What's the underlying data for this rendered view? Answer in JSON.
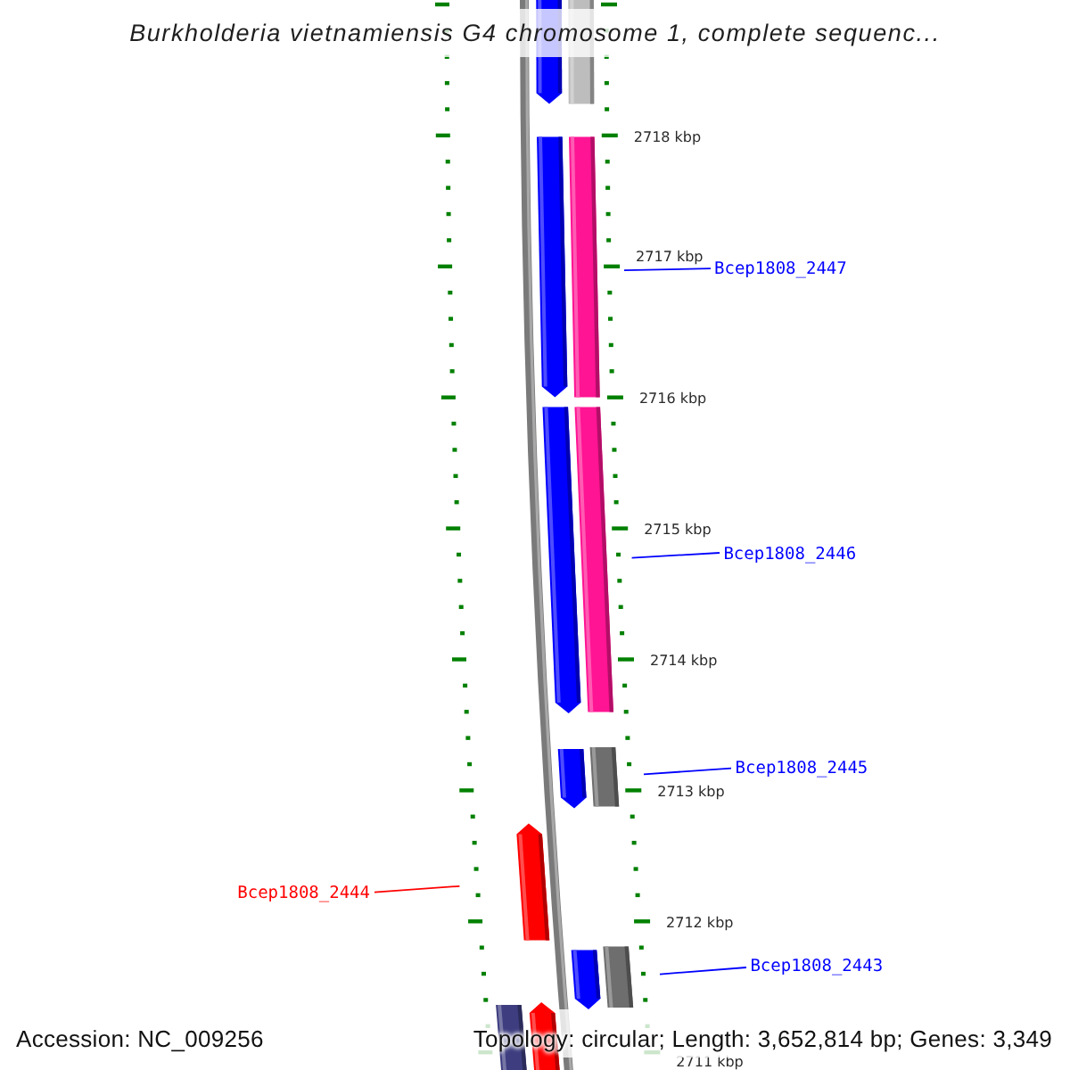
{
  "title": "Burkholderia vietnamiensis G4 chromosome 1, complete sequenc...",
  "map": {
    "tick_labels": [
      "2718 kbp",
      "2717 kbp",
      "2716 kbp",
      "2715 kbp",
      "2714 kbp",
      "2713 kbp",
      "2712 kbp",
      "2711 kbp"
    ],
    "features": [
      {
        "kind": "forward",
        "color": "#0000ff"
      },
      {
        "kind": "block",
        "color": "#bdbdbd"
      },
      {
        "kind": "forward",
        "color": "#0000ff"
      },
      {
        "kind": "block",
        "color": "#ff1493"
      },
      {
        "kind": "forward",
        "color": "#0000ff"
      },
      {
        "kind": "block",
        "color": "#ff1493"
      },
      {
        "kind": "forward",
        "color": "#0000ff"
      },
      {
        "kind": "block",
        "color": "#6e6e6e"
      },
      {
        "kind": "reverse",
        "color": "#ff0000"
      },
      {
        "kind": "forward",
        "color": "#0000ff"
      },
      {
        "kind": "block",
        "color": "#6e6e6e"
      },
      {
        "kind": "block",
        "color": "#3d3d80"
      },
      {
        "kind": "reverse",
        "color": "#ff0000"
      }
    ],
    "gene_labels": [
      {
        "text": "Bcep1808_2447",
        "color": "#0000ff"
      },
      {
        "text": "Bcep1808_2446",
        "color": "#0000ff"
      },
      {
        "text": "Bcep1808_2445",
        "color": "#0000ff"
      },
      {
        "text": "Bcep1808_2444",
        "color": "#ff0000"
      },
      {
        "text": "Bcep1808_2443",
        "color": "#0000ff"
      }
    ]
  },
  "footer": {
    "accession": "Accession: NC_009256",
    "stats": "Topology: circular; Length: 3,652,814 bp; Genes: 3,349"
  }
}
